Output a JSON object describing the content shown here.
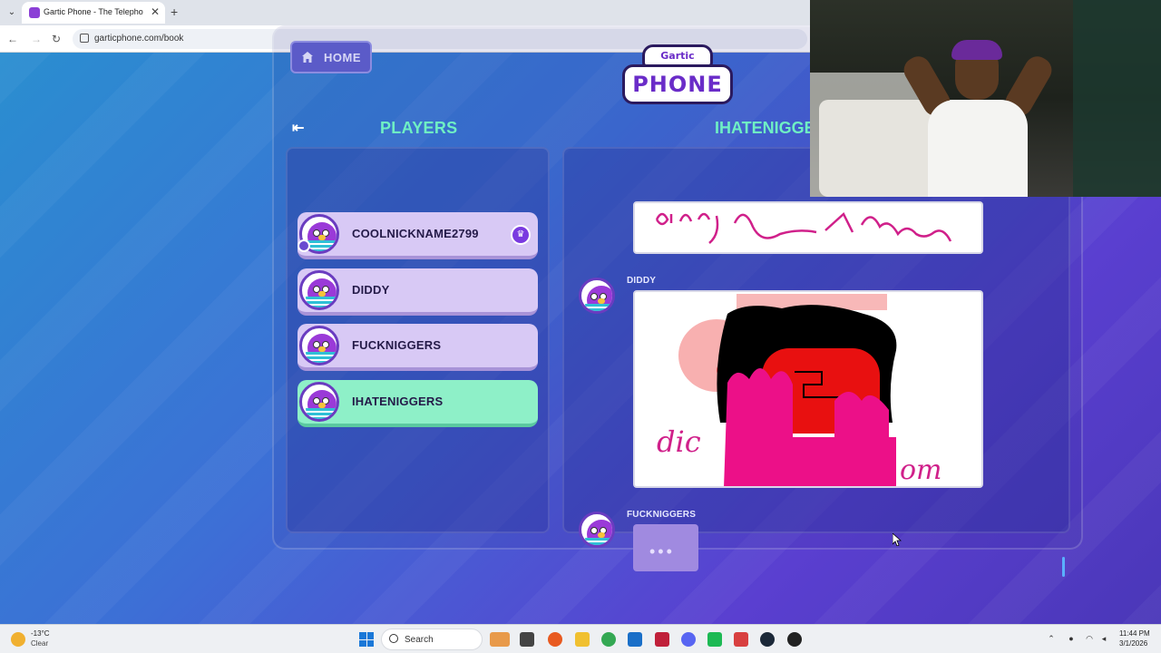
{
  "browser": {
    "tab_title": "Gartic Phone - The Telephone G",
    "tab_close": "✕",
    "new_tab": "+",
    "url": "garticphone.com/book"
  },
  "game": {
    "home_label": "HOME",
    "logo_top": "Gartic",
    "logo_bottom": "PHONE",
    "players_title": "PLAYERS",
    "album_title": "IHATENIGGE",
    "players": [
      {
        "name": "COOLNICKNAME2799",
        "host": true,
        "active": false
      },
      {
        "name": "DIDDY",
        "host": false,
        "active": false
      },
      {
        "name": "FUCKNIGGERS",
        "host": false,
        "active": false
      },
      {
        "name": "IHATENIGGERS",
        "host": false,
        "active": true
      }
    ],
    "album": {
      "messages": [
        {
          "author": "DIDDY",
          "type": "drawing",
          "caption_left": "dic",
          "caption_right": "om"
        },
        {
          "author": "FUCKNIGGERS",
          "type": "typing",
          "indicator": "•••"
        }
      ],
      "top_caption": "diddy mom"
    }
  },
  "taskbar": {
    "weather_temp": "-13°C",
    "weather_desc": "Clear",
    "search_label": "Search",
    "clock_time": "11:44 PM",
    "clock_date": "3/1/2026"
  },
  "colors": {
    "accent_green": "#6ff0c4",
    "active_row": "#8ef0c8",
    "player_row": "#d8c9f5",
    "brand_purple": "#6a2cc8"
  }
}
